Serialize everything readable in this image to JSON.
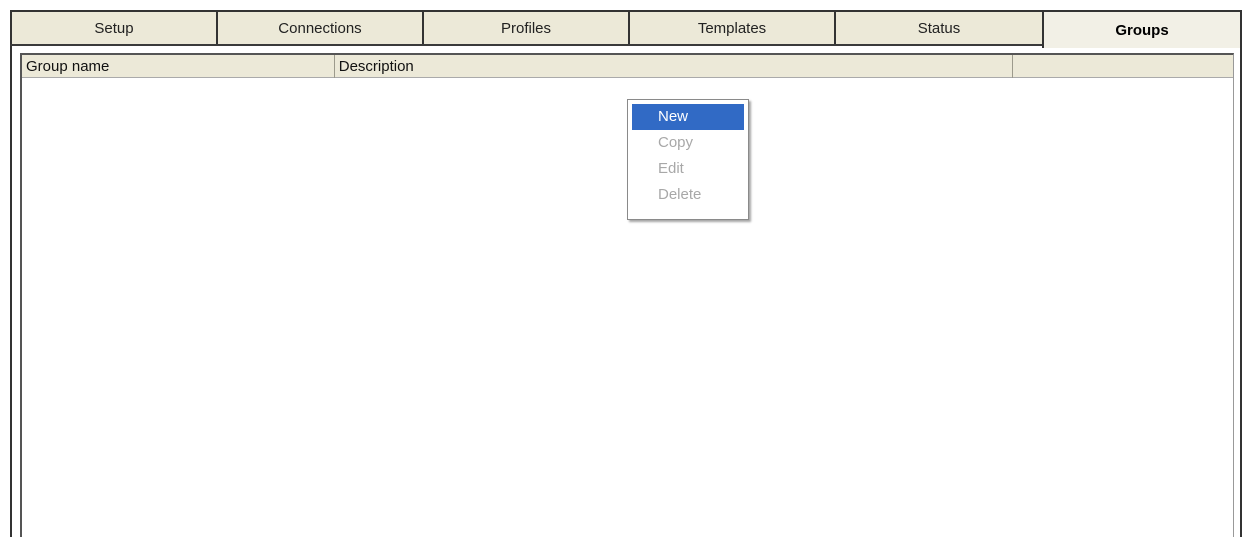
{
  "tabs": [
    {
      "label": "Setup"
    },
    {
      "label": "Connections"
    },
    {
      "label": "Profiles"
    },
    {
      "label": "Templates"
    },
    {
      "label": "Status"
    },
    {
      "label": "Groups",
      "active": true
    }
  ],
  "list": {
    "columns": [
      {
        "label": "Group name"
      },
      {
        "label": "Description"
      },
      {
        "label": ""
      }
    ],
    "rows": []
  },
  "context_menu": {
    "items": [
      {
        "label": "New",
        "enabled": true,
        "highlighted": true
      },
      {
        "label": "Copy",
        "enabled": false
      },
      {
        "label": "Edit",
        "enabled": false
      },
      {
        "label": "Delete",
        "enabled": false
      }
    ]
  },
  "colors": {
    "tab_background": "#ece9d8",
    "menu_highlight": "#316ac5",
    "disabled_text": "#a8a8a8"
  }
}
